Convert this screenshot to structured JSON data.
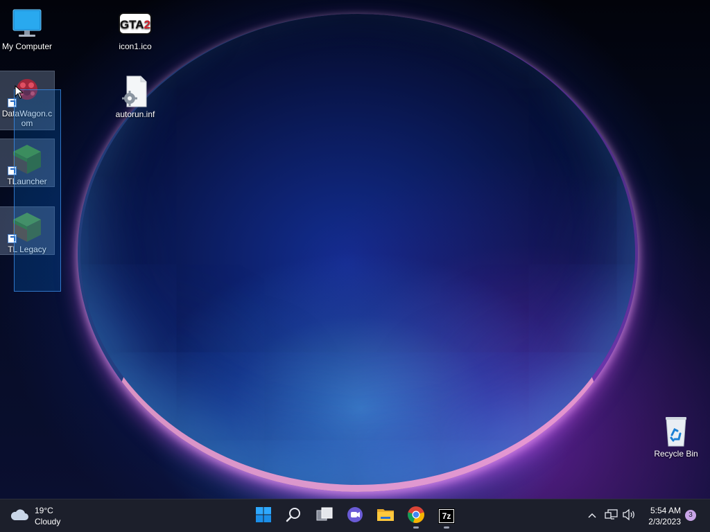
{
  "desktop": {
    "icons": [
      {
        "label": "My Computer",
        "icon": "monitor-icon"
      },
      {
        "label": "icon1.ico",
        "icon": "gta2-logo-icon"
      },
      {
        "label": "DataWagon.com",
        "icon": "datawagon-icon",
        "shortcut": true,
        "selected": true
      },
      {
        "label": "autorun.inf",
        "icon": "settings-file-icon"
      },
      {
        "label": "TLauncher",
        "icon": "grass-block-icon",
        "shortcut": true,
        "selected": true
      },
      {
        "label": "TL Legacy",
        "icon": "grass-block-icon",
        "shortcut": true,
        "selected": true
      },
      {
        "label": "Recycle Bin",
        "icon": "recycle-bin-icon"
      }
    ],
    "gta2_logo_text": "GTA2"
  },
  "taskbar": {
    "weather": {
      "temp": "19°C",
      "condition": "Cloudy",
      "icon": "cloud-icon"
    },
    "apps": [
      {
        "name": "start",
        "icon": "windows-logo-icon"
      },
      {
        "name": "search",
        "icon": "search-icon"
      },
      {
        "name": "task-view",
        "icon": "task-view-icon"
      },
      {
        "name": "chat",
        "icon": "teams-chat-icon"
      },
      {
        "name": "file-explorer",
        "icon": "folder-icon"
      },
      {
        "name": "chrome",
        "icon": "chrome-icon",
        "running": true
      },
      {
        "name": "7zip",
        "icon": "7zip-icon",
        "running": true,
        "label": "7z"
      }
    ],
    "tray": {
      "chevron_icon": "chevron-up-icon",
      "network_icon": "network-icon",
      "volume_icon": "volume-icon",
      "time": "5:54 AM",
      "date": "2/3/2023",
      "notifications": "3"
    }
  },
  "colors": {
    "taskbar_bg": "#1c1f2b",
    "selection": "#0066cc",
    "accent_blue": "#0078d4"
  }
}
